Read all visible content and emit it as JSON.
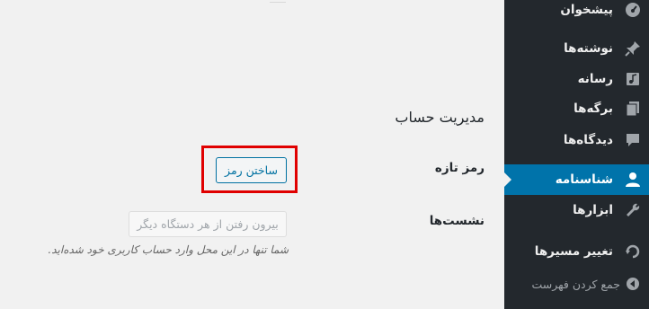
{
  "sidebar": {
    "items": [
      {
        "label": "پیشخوان",
        "icon": "dashboard-icon"
      },
      {
        "label": "نوشته‌ها",
        "icon": "pin-icon"
      },
      {
        "label": "رسانه",
        "icon": "media-icon"
      },
      {
        "label": "برگه‌ها",
        "icon": "pages-icon"
      },
      {
        "label": "دیدگاه‌ها",
        "icon": "comment-icon"
      },
      {
        "label": "شناسنامه",
        "icon": "user-icon",
        "current": true
      },
      {
        "label": "ابزارها",
        "icon": "wrench-icon"
      },
      {
        "label": "تغییر مسیرها",
        "icon": "redirect-icon"
      },
      {
        "label": "جمع کردن فهرست",
        "icon": "collapse-icon"
      }
    ]
  },
  "account": {
    "title": "مدیریت حساب",
    "new_password_label": "رمز تازه",
    "generate_password_button": "ساختن رمز",
    "sessions_label": "نشست‌ها",
    "logout_everywhere_button": "بیرون رفتن از هر دستگاه دیگر",
    "sessions_description": "شما تنها در این محل وارد حساب کاربری خود شده‌اید."
  },
  "colors": {
    "sidebar_bg": "#23282d",
    "current_bg": "#0073aa",
    "highlight": "#e00000"
  }
}
